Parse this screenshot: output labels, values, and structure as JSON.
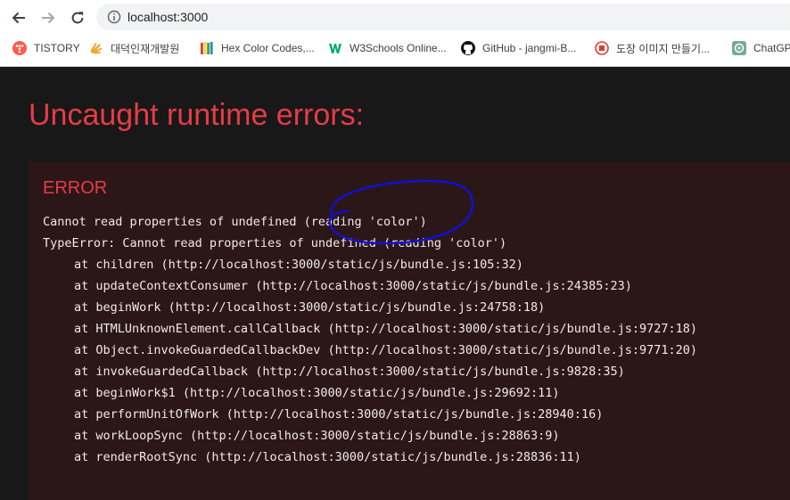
{
  "browser": {
    "address": "localhost:3000",
    "bookmarks": [
      {
        "label": "TISTORY",
        "icon": "tistory-icon",
        "color": "#ff5a4a"
      },
      {
        "label": "대덕인재개발원",
        "icon": "hand-icon",
        "color": "#f5a623"
      },
      {
        "label": "Hex Color Codes,...",
        "icon": "color-bars-icon",
        "color": "#7b61ff"
      },
      {
        "label": "W3Schools Online...",
        "icon": "w3schools-icon",
        "color": "#04aa6d"
      },
      {
        "label": "GitHub - jangmi-B...",
        "icon": "github-icon",
        "color": "#111111"
      },
      {
        "label": "도장 이미지 만들기...",
        "icon": "stamp-icon",
        "color": "#e53935"
      },
      {
        "label": "ChatGPT",
        "icon": "chatgpt-icon",
        "color": "#74aa9c"
      }
    ]
  },
  "overlay": {
    "title": "Uncaught runtime errors:",
    "error_label": "ERROR",
    "message": "Cannot read properties of undefined (reading 'color')",
    "type_line": "TypeError: Cannot read properties of undefined (reading 'color')",
    "stack": [
      "at children (http://localhost:3000/static/js/bundle.js:105:32)",
      "at updateContextConsumer (http://localhost:3000/static/js/bundle.js:24385:23)",
      "at beginWork (http://localhost:3000/static/js/bundle.js:24758:18)",
      "at HTMLUnknownElement.callCallback (http://localhost:3000/static/js/bundle.js:9727:18)",
      "at Object.invokeGuardedCallbackDev (http://localhost:3000/static/js/bundle.js:9771:20)",
      "at invokeGuardedCallback (http://localhost:3000/static/js/bundle.js:9828:35)",
      "at beginWork$1 (http://localhost:3000/static/js/bundle.js:29692:11)",
      "at performUnitOfWork (http://localhost:3000/static/js/bundle.js:28940:16)",
      "at workLoopSync (http://localhost:3000/static/js/bundle.js:28863:9)",
      "at renderRootSync (http://localhost:3000/static/js/bundle.js:28836:11)"
    ]
  },
  "colors": {
    "page_background": "#181818",
    "error_box_background": "#2b1718",
    "error_red": "#e83b46",
    "annotation_blue": "#1010d8"
  }
}
